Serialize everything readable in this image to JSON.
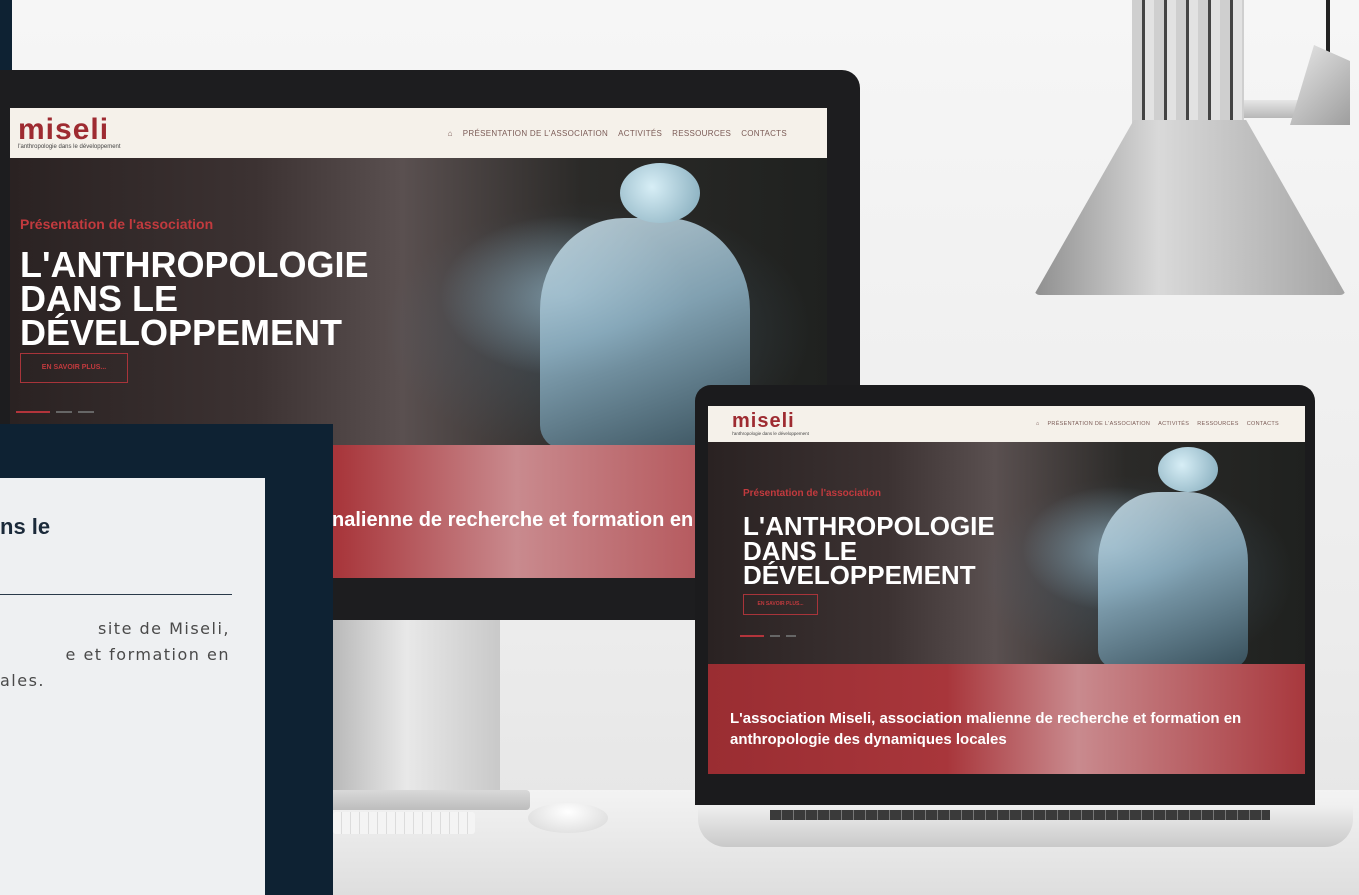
{
  "site": {
    "logo": "miseli",
    "tagline": "l'anthropologie dans le développement",
    "menu": [
      "PRÉSENTATION DE L'ASSOCIATION",
      "ACTIVITÉS",
      "RESSOURCES",
      "CONTACTS"
    ]
  },
  "hero": {
    "kicker": "Présentation de l'association",
    "headline_line1": "L'ANTHROPOLOGIE",
    "headline_line2": "DANS LE DÉVELOPPEMENT",
    "cta": "EN SAVOIR PLUS..."
  },
  "band": {
    "big_visible": "nalienne de recherche et formation en cales",
    "laptop_text": "L'association Miseli, association malienne de recherche et formation en anthropologie des dynamiques locales"
  },
  "card": {
    "title": "ns le",
    "body_line1": "site de Miseli,",
    "body_line2": "e et formation en",
    "body_line3": "ales."
  },
  "colors": {
    "navy": "#0e2233",
    "brand_red": "#9e2b31"
  }
}
